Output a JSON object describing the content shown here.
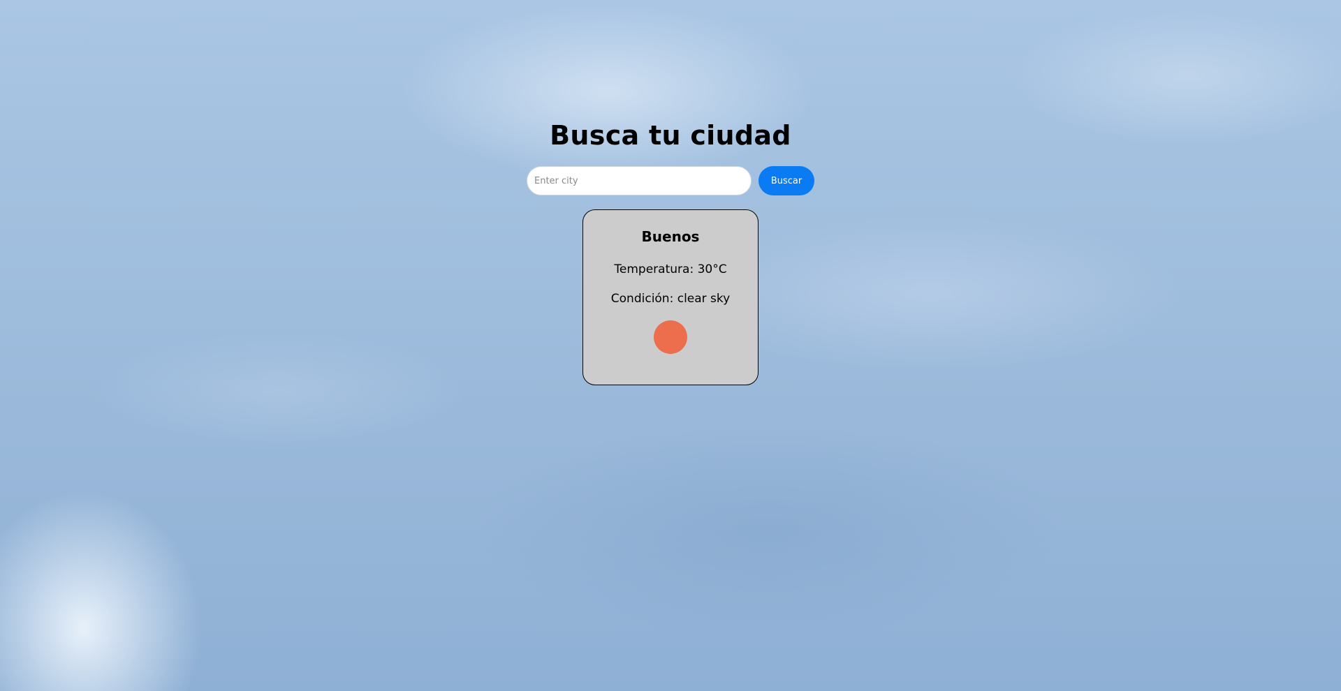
{
  "header": {
    "title": "Busca tu ciudad"
  },
  "search": {
    "placeholder": "Enter city",
    "value": "",
    "button_label": "Buscar"
  },
  "weather": {
    "city": "Buenos",
    "temperature_text": "Temperatura: 30°C",
    "condition_text": "Condición: clear sky",
    "icon": "sun-icon"
  },
  "colors": {
    "accent": "#0a7bf2",
    "card_background": "#cccccc",
    "sun": "#ec6e4c"
  }
}
